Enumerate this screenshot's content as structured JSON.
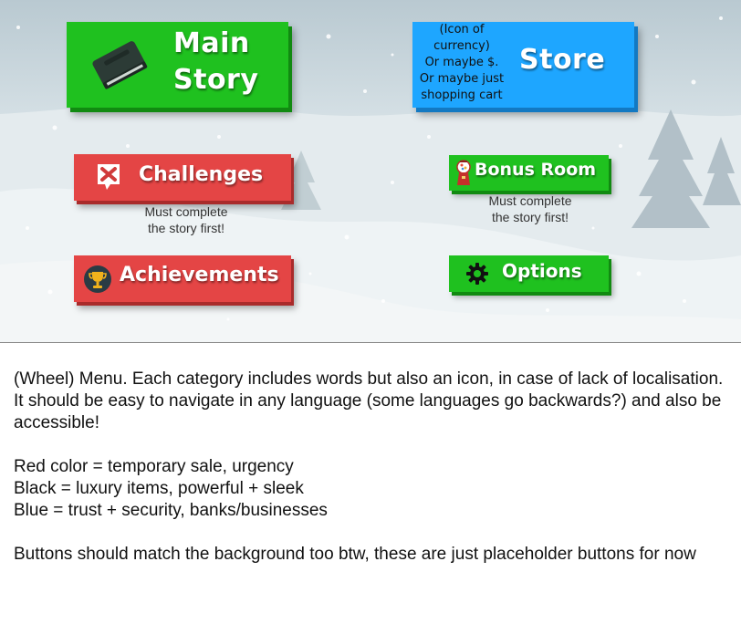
{
  "menu": {
    "main_story": {
      "label": "Main\nStory",
      "icon": "book-icon"
    },
    "store": {
      "label": "Store",
      "icon_placeholder": "(Icon of\ncurrency)\nOr maybe $.\nOr maybe just\nshopping cart"
    },
    "challenges": {
      "label": "Challenges",
      "icon": "challenge-card-icon",
      "note": "Must complete\nthe story first!"
    },
    "bonus_room": {
      "label": "Bonus Room",
      "icon": "gumball-machine-icon",
      "note": "Must complete\nthe story first!"
    },
    "achievements": {
      "label": "Achievements",
      "icon": "trophy-icon"
    },
    "options": {
      "label": "Options",
      "icon": "gear-icon"
    }
  },
  "notes": {
    "intro": "(Wheel) Menu.  Each category includes words but also an icon, in case of lack of localisation.  It should be easy to navigate in any language (some languages go backwards?)  and also be accessible!",
    "colors": [
      "Red color = temporary sale, urgency",
      "Black = luxury items, powerful + sleek",
      "Blue = trust + security, banks/businesses"
    ],
    "footer": "Buttons should match the background too btw, these are just placeholder buttons for now"
  },
  "colors": {
    "green": "#1fc11f",
    "blue": "#1ea6ff",
    "red": "#e44545",
    "snow": "#eef2f4",
    "sky": "#c9d6dc"
  }
}
